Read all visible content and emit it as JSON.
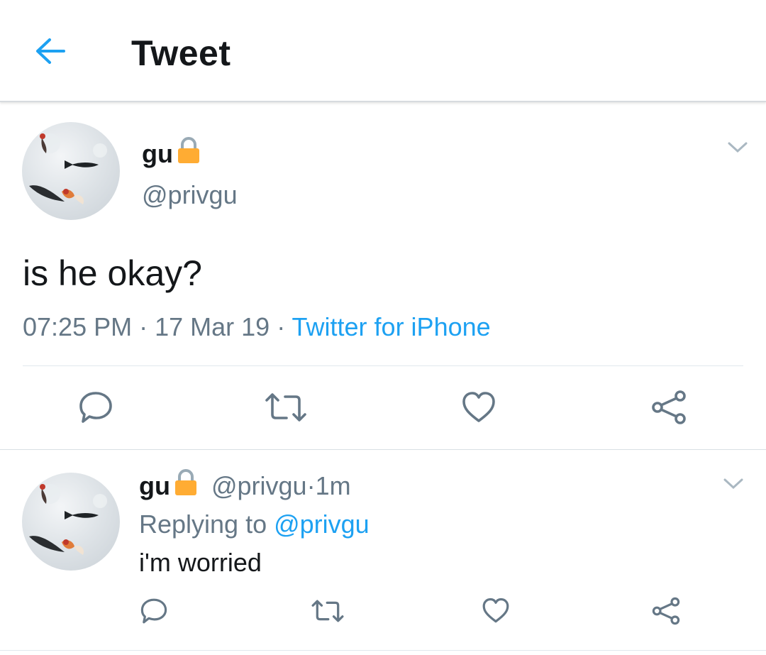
{
  "colors": {
    "accent": "#1da1f2",
    "text": "#14171a",
    "secondary": "#657786",
    "lock": "#ffac33"
  },
  "header": {
    "title": "Tweet",
    "back_icon": "arrow-left-icon"
  },
  "tweet": {
    "author_name": "gu",
    "author_handle": "@privgu",
    "text": "is he okay?",
    "time": "07:25 PM",
    "sep1": " · ",
    "date": "17 Mar 19",
    "sep2": " · ",
    "source": "Twitter for iPhone",
    "actions": [
      "reply-icon",
      "retweet-icon",
      "like-icon",
      "share-icon"
    ]
  },
  "reply": {
    "author_name": "gu",
    "author_handle": "@privgu",
    "sep": " · ",
    "age": "1m",
    "replying_prefix": "Replying to ",
    "replying_to": "@privgu",
    "text": "i'm worried",
    "actions": [
      "reply-icon",
      "retweet-icon",
      "like-icon",
      "share-icon"
    ]
  }
}
